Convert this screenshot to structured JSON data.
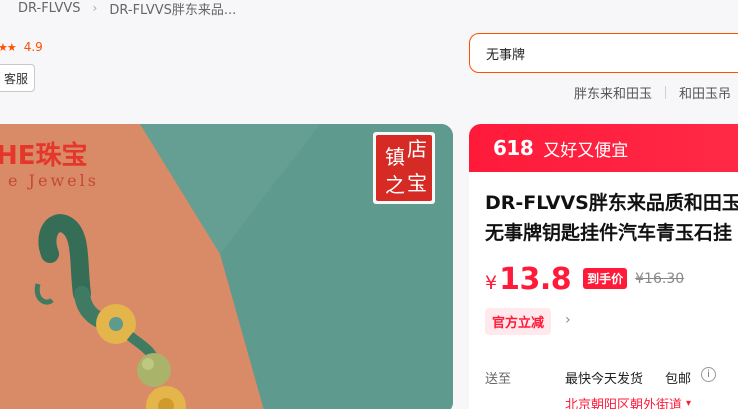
{
  "breadcrumb": {
    "items": [
      "DR-FLVVS",
      "DR-FLVVS胖东来品..."
    ]
  },
  "shop": {
    "rating": "4.9",
    "service_button": "客服"
  },
  "search": {
    "value": "无事牌",
    "hot_words": [
      "胖东来和田玉",
      "和田玉吊"
    ]
  },
  "product_image": {
    "brand_text": "HE珠宝",
    "brand_sub": "e Jewels",
    "seal_chars": [
      "镇",
      "店",
      "之",
      "宝"
    ]
  },
  "promo": {
    "badge": "618",
    "text": "又好又便宜"
  },
  "product": {
    "title_line1": "DR-FLVVS胖东来品质和田玉",
    "title_line2": "无事牌钥匙挂件汽车青玉石挂",
    "price_symbol": "¥",
    "price": "13.8",
    "price_tag": "到手价",
    "original_price": "¥16.30",
    "coupon": "官方立减"
  },
  "delivery": {
    "label": "送至",
    "speed": "最快今天发货",
    "free_shipping": "包邮",
    "address": "北京朝阳区朝外街道"
  },
  "colors": {
    "accent": "#ff1a3a",
    "search_border": "#ff5000",
    "image_teal": "#5e9a8e",
    "image_orange": "#d98b67"
  }
}
